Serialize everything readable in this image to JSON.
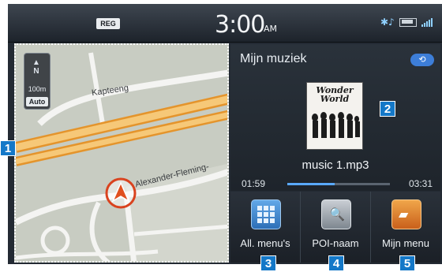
{
  "status_bar": {
    "reg_label": "REG",
    "time": "3:00",
    "ampm": "AM",
    "icons": [
      "bluetooth-audio-icon",
      "battery-icon",
      "signal-icon"
    ]
  },
  "map": {
    "scale": "100m",
    "mode": "Auto",
    "compass": "N",
    "streets": [
      "Kapteeng",
      "Alexander-Fleming-"
    ]
  },
  "media": {
    "title": "Mijn muziek",
    "album_title": "Wonder World",
    "track": "music 1.mp3",
    "time_current": "01:59",
    "time_total": "03:31",
    "progress": 0.46
  },
  "buttons": [
    {
      "label": "All. menu's",
      "icon": "grid-menu-icon"
    },
    {
      "label": "POI-naam",
      "icon": "poi-search-icon"
    },
    {
      "label": "Mijn menu",
      "icon": "folder-icon"
    }
  ],
  "callouts": [
    "1",
    "2",
    "3",
    "4",
    "5"
  ],
  "colors": {
    "callout": "#1478c8",
    "accent": "#59a9ff"
  }
}
